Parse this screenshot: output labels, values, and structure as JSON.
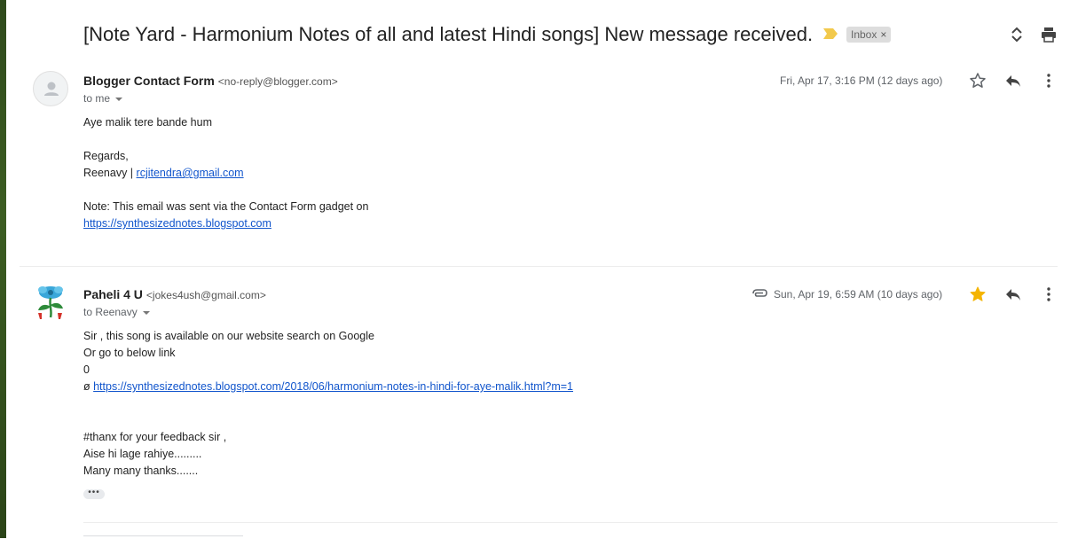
{
  "thread": {
    "subject": "[Note Yard - Harmonium Notes of all and latest Hindi songs] New message received.",
    "label": "Inbox",
    "label_close": "×",
    "importance_color": "#f2c94c"
  },
  "messages": [
    {
      "sender_name": "Blogger Contact Form",
      "sender_email": "<no-reply@blogger.com>",
      "recipient": "to me",
      "date": "Fri, Apr 17, 3:16 PM (12 days ago)",
      "starred": false,
      "avatar": "person-icon",
      "body": {
        "line1": "Aye malik tere bande hum",
        "line2": "Regards,",
        "line3_prefix": "Reenavy | ",
        "line3_link": "rcjitendra@gmail.com",
        "line4": "Note: This email was sent via the Contact Form gadget on",
        "line5_link": "https://synthesizednotes.blogspot.com"
      }
    },
    {
      "sender_name": "Paheli 4 U",
      "sender_email": "<jokes4ush@gmail.com>",
      "recipient": "to Reenavy",
      "date": "Sun, Apr 19, 6:59 AM (10 days ago)",
      "starred": true,
      "has_attachment": true,
      "avatar": "flower-logo",
      "body": {
        "line1": "Sir , this song is available on our website search on Google",
        "line2": "Or go to below link",
        "line3": "0",
        "line4_prefix": "ø ",
        "line4_link": "https://synthesizednotes.blogspot.com/2018/06/harmonium-notes-in-hindi-for-aye-malik.html?m=1",
        "line5": "#thanx for your feedback sir ,",
        "line6": "Aise hi lage rahiye.........",
        "line7": "Many many thanks......."
      },
      "trimmed_content": "•••"
    }
  ],
  "colors": {
    "link": "#1155cc",
    "star_filled": "#f4b400",
    "icon_gray": "#5f6368"
  }
}
